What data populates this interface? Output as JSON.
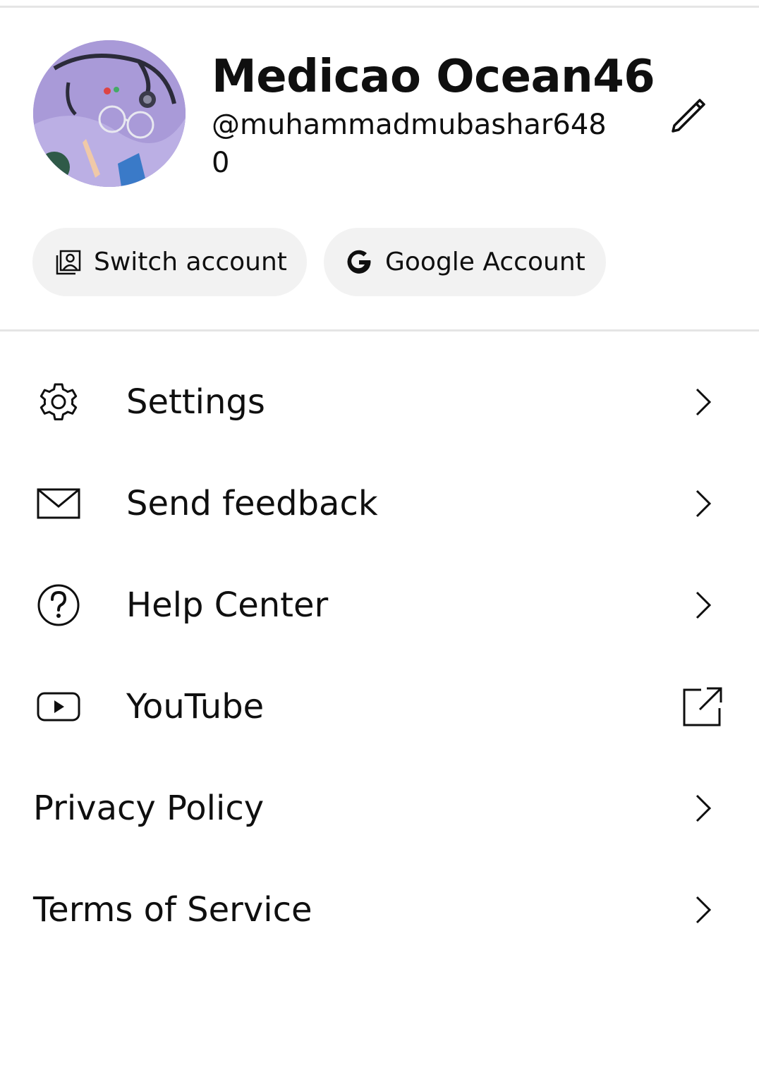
{
  "profile": {
    "display_name": "Medicao Ocean46",
    "handle": "@muhammadmubashar6480",
    "avatar_description": "profile photo"
  },
  "chips": {
    "switch_account": "Switch account",
    "google_account": "Google Account"
  },
  "menu": [
    {
      "label": "Settings",
      "icon": "gear-icon",
      "trailing": "chevron-right-icon"
    },
    {
      "label": "Send feedback",
      "icon": "mail-icon",
      "trailing": "chevron-right-icon"
    },
    {
      "label": "Help Center",
      "icon": "help-circle-icon",
      "trailing": "chevron-right-icon"
    },
    {
      "label": "YouTube",
      "icon": "youtube-icon",
      "trailing": "external-link-icon"
    },
    {
      "label": "Privacy Policy",
      "icon": "",
      "trailing": "chevron-right-icon"
    },
    {
      "label": "Terms of Service",
      "icon": "",
      "trailing": "chevron-right-icon"
    }
  ],
  "colors": {
    "text": "#0f0f0f",
    "chip_background": "#f2f2f2",
    "divider": "#e5e5e5",
    "avatar_tint": "#9d8fcf"
  }
}
